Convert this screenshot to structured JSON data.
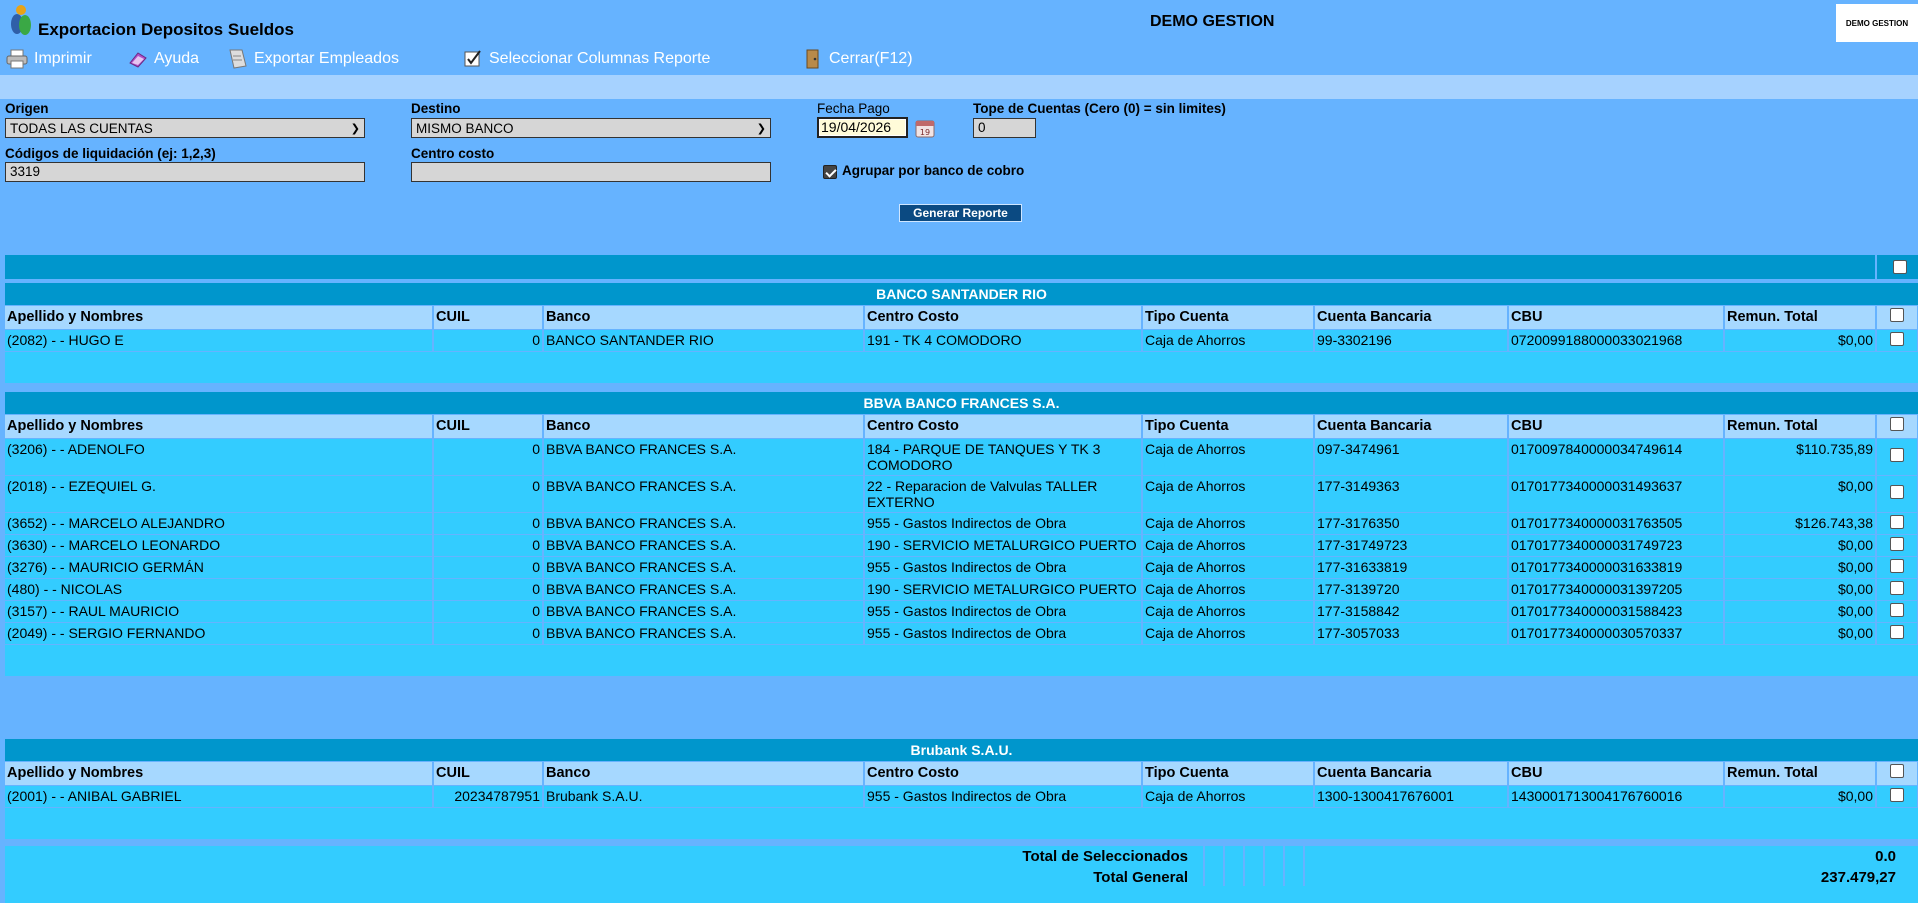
{
  "window": {
    "app_title": "Exportacion Depositos Sueldos",
    "company_title": "DEMO GESTION",
    "company_badge": "DEMO GESTION"
  },
  "toolbar": [
    {
      "label": "Imprimir",
      "icon": "printer-icon"
    },
    {
      "label": "Ayuda",
      "icon": "help-book-icon"
    },
    {
      "label": "Exportar Empleados",
      "icon": "export-icon"
    },
    {
      "label": "Seleccionar Columnas Reporte",
      "icon": "checklist-icon"
    },
    {
      "label": "Cerrar(F12)",
      "icon": "close-door-icon"
    }
  ],
  "form": {
    "origen_label": "Origen",
    "origen_value": "TODAS LAS CUENTAS",
    "destino_label": "Destino",
    "destino_value": "MISMO BANCO",
    "fecha_label": "Fecha Pago",
    "fecha_value": "19/04/2026",
    "tope_label": "Tope de Cuentas (Cero (0) = sin limites)",
    "tope_value": "0",
    "codigos_label": "Códigos de liquidación (ej: 1,2,3)",
    "codigos_value": "3319",
    "centro_label": "Centro costo",
    "centro_value": "",
    "agrupar_label": "Agrupar por banco de cobro",
    "agrupar_checked": true,
    "generar_label": "Generar Reporte"
  },
  "columns": [
    "Apellido y Nombres",
    "CUIL",
    "Banco",
    "Centro Costo",
    "Tipo Cuenta",
    "Cuenta Bancaria",
    "CBU",
    "Remun. Total"
  ],
  "groups": [
    {
      "bank": "BANCO SANTANDER RIO",
      "rows": [
        {
          "nombre": "(2082) - - HUGO E",
          "cuil": "0",
          "banco": "BANCO SANTANDER RIO",
          "centro": "191 - TK 4 COMODORO",
          "tipo": "Caja de Ahorros",
          "cuenta": "99-3302196",
          "cbu": "0720099188000033021968",
          "remun": "$0,00"
        }
      ]
    },
    {
      "bank": "BBVA BANCO FRANCES S.A.",
      "rows": [
        {
          "nombre": "(3206) - - ADENOLFO",
          "cuil": "0",
          "banco": "BBVA BANCO FRANCES S.A.",
          "centro": "184 - PARQUE DE TANQUES Y TK 3 COMODORO",
          "tipo": "Caja de Ahorros",
          "cuenta": "097-3474961",
          "cbu": "0170097840000034749614",
          "remun": "$110.735,89"
        },
        {
          "nombre": "(2018) - - EZEQUIEL G.",
          "cuil": "0",
          "banco": "BBVA BANCO FRANCES S.A.",
          "centro": "22 - Reparacion de Valvulas TALLER EXTERNO",
          "tipo": "Caja de Ahorros",
          "cuenta": "177-3149363",
          "cbu": "0170177340000031493637",
          "remun": "$0,00"
        },
        {
          "nombre": "(3652) - - MARCELO ALEJANDRO",
          "cuil": "0",
          "banco": "BBVA BANCO FRANCES S.A.",
          "centro": "955 - Gastos Indirectos de Obra",
          "tipo": "Caja de Ahorros",
          "cuenta": "177-3176350",
          "cbu": "0170177340000031763505",
          "remun": "$126.743,38"
        },
        {
          "nombre": "(3630) - - MARCELO LEONARDO",
          "cuil": "0",
          "banco": "BBVA BANCO FRANCES S.A.",
          "centro": "190 - SERVICIO METALURGICO PUERTO",
          "tipo": "Caja de Ahorros",
          "cuenta": "177-31749723",
          "cbu": "0170177340000031749723",
          "remun": "$0,00"
        },
        {
          "nombre": "(3276) - - MAURICIO GERMÁN",
          "cuil": "0",
          "banco": "BBVA BANCO FRANCES S.A.",
          "centro": "955 - Gastos Indirectos de Obra",
          "tipo": "Caja de Ahorros",
          "cuenta": "177-31633819",
          "cbu": "0170177340000031633819",
          "remun": "$0,00"
        },
        {
          "nombre": "(480) - - NICOLAS",
          "cuil": "0",
          "banco": "BBVA BANCO FRANCES S.A.",
          "centro": "190 - SERVICIO METALURGICO PUERTO",
          "tipo": "Caja de Ahorros",
          "cuenta": "177-3139720",
          "cbu": "0170177340000031397205",
          "remun": "$0,00"
        },
        {
          "nombre": "(3157) - - RAUL MAURICIO",
          "cuil": "0",
          "banco": "BBVA BANCO FRANCES S.A.",
          "centro": "955 - Gastos Indirectos de Obra",
          "tipo": "Caja de Ahorros",
          "cuenta": "177-3158842",
          "cbu": "0170177340000031588423",
          "remun": "$0,00"
        },
        {
          "nombre": "(2049) - - SERGIO FERNANDO",
          "cuil": "0",
          "banco": "BBVA BANCO FRANCES S.A.",
          "centro": "955 - Gastos Indirectos de Obra",
          "tipo": "Caja de Ahorros",
          "cuenta": "177-3057033",
          "cbu": "0170177340000030570337",
          "remun": "$0,00"
        }
      ]
    },
    {
      "bank": "Brubank S.A.U.",
      "rows": [
        {
          "nombre": "(2001) - - ANIBAL GABRIEL",
          "cuil": "20234787951",
          "banco": "Brubank S.A.U.",
          "centro": "955 - Gastos Indirectos de Obra",
          "tipo": "Caja de Ahorros",
          "cuenta": "1300-1300417676001",
          "cbu": "1430001713004176760016",
          "remun": "$0,00"
        }
      ]
    }
  ],
  "totals": {
    "seleccionados_label": "Total de Seleccionados",
    "seleccionados_value": "0.0",
    "general_label": "Total General",
    "general_value": "237.479,27"
  }
}
